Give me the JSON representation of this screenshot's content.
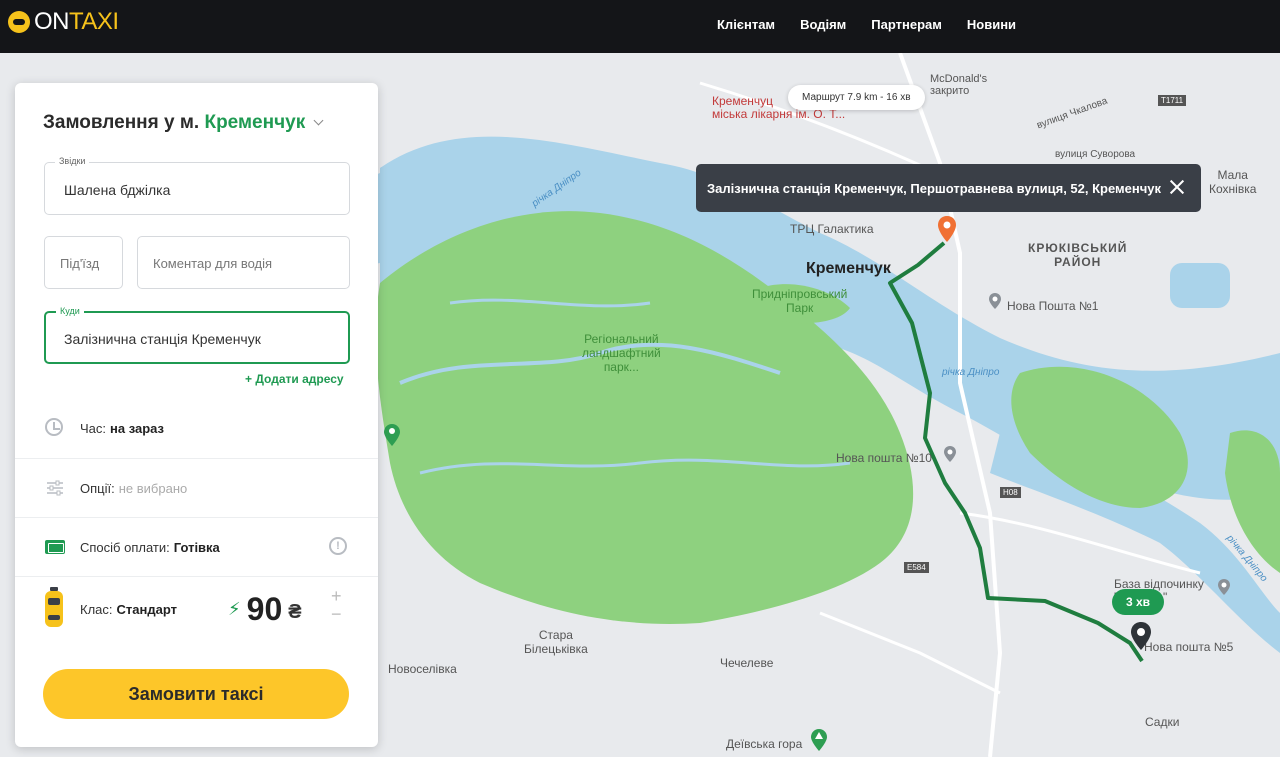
{
  "header": {
    "logo_on": "ON",
    "logo_taxi": "TAXI",
    "nav": [
      "Клієнтам",
      "Водіям",
      "Партнерам",
      "Новини"
    ]
  },
  "panel": {
    "title_prefix": "Замовлення у м.",
    "city": "Кременчук",
    "from": {
      "legend": "Звідки",
      "value": "Шалена бджілка"
    },
    "entrance_placeholder": "Під'їзд",
    "comment_placeholder": "Коментар для водія",
    "to": {
      "legend": "Куди",
      "value": "Залізнична станція Кременчук"
    },
    "add_address": "+ Додати адресу",
    "time": {
      "label": "Час:",
      "value": "на зараз"
    },
    "options": {
      "label": "Опції:",
      "value": "не вибрано"
    },
    "payment": {
      "label": "Спосіб оплати:",
      "value": "Готівка"
    },
    "class": {
      "label": "Клас:",
      "value": "Стандарт"
    },
    "price": "90",
    "currency": "₴",
    "plus": "+",
    "minus": "−",
    "order_button": "Замовити таксі"
  },
  "map": {
    "route_summary": "Маршрут 7.9 km - 16 хв",
    "tooltip": "Залізнична станція Кременчук, Першотравнева вулиця, 52, Кременчук",
    "eta": "3 хв",
    "labels": {
      "kremenchuk": "Кременчук",
      "kriukivskyi": "КРЮКІВСЬКИЙ\nРАЙОН",
      "regional_park": "Регіональний\nландшафтний\nпарк...",
      "prydniprovskyi": "Придніпровський\nПарк",
      "galaktyka": "ТРЦ Галактика",
      "nova_poshta_1": "Нова Пошта №1",
      "nova_poshta_10": "Нова пошта №10",
      "nova_poshta_5": "Нова пошта №5",
      "stara_biletskivka": "Стара\nБілецьківка",
      "novoselivka": "Новоселівка",
      "chechelevo": "Чечелеве",
      "deivska_hora": "Деївська гора",
      "sadky": "Садки",
      "mala_kokhnivka": "Мала\nКохнівка",
      "hospital": "Кременчуц\nміська лікарня ім. О. Т...",
      "mcdonalds": "McDonald's\nзакрито",
      "baza": "База відпочинку\n\"Шарада\"",
      "river1": "річка Дніпро",
      "river2": "річка Дніпро",
      "river3": "річка Дніпро",
      "street_chkalova": "вулиця Чкалова",
      "street_suvorova": "вулиця Суворова",
      "road_h08": "H08",
      "road_e584": "E584",
      "road_t1711": "T1711"
    }
  },
  "colors": {
    "accent_green": "#1f9a52",
    "brand_yellow": "#fdc629",
    "water": "#aad3ea",
    "park": "#8ed17f"
  }
}
